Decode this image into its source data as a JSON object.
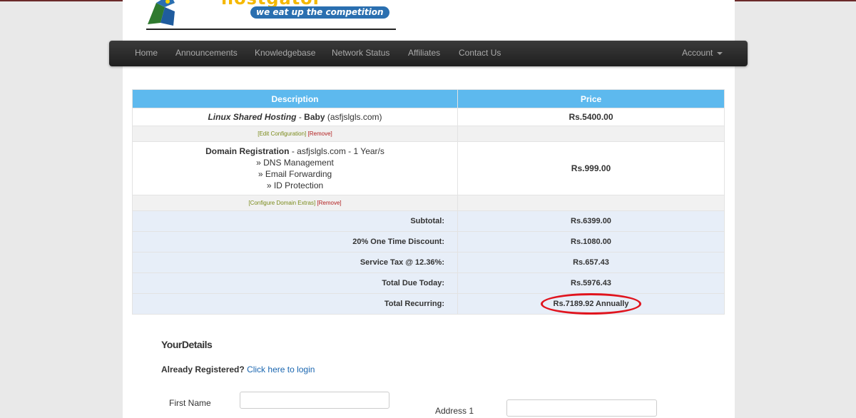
{
  "logo": {
    "brand_text": "hostgator",
    "tagline": "we eat up the competition"
  },
  "navbar": {
    "items": [
      "Home",
      "Announcements",
      "Knowledgebase",
      "Network Status",
      "Affiliates",
      "Contact Us"
    ],
    "account": "Account"
  },
  "cart": {
    "headers": {
      "description": "Description",
      "price": "Price"
    },
    "hosting": {
      "product": "Linux Shared Hosting",
      "separator": " - ",
      "plan": "Baby",
      "domain": " (asfjslgls.com)",
      "price": "Rs.5400.00",
      "edit": "[Edit Configuration]",
      "remove": "[Remove]"
    },
    "domain_reg": {
      "title": "Domain Registration",
      "detail": " - asfjslgls.com - 1 Year/s",
      "addons": [
        "» DNS Management",
        "» Email Forwarding",
        "» ID Protection"
      ],
      "price": "Rs.999.00",
      "configure": "[Configure Domain Extras]",
      "remove": "[Remove]"
    },
    "summary": [
      {
        "label": "Subtotal:",
        "value": "Rs.6399.00"
      },
      {
        "label": "20% One Time Discount:",
        "value": "Rs.1080.00"
      },
      {
        "label": "Service Tax @ 12.36%:",
        "value": "Rs.657.43"
      },
      {
        "label": "Total Due Today:",
        "value": "Rs.5976.43"
      },
      {
        "label": "Total Recurring:",
        "value": "Rs.7189.92 Annually"
      }
    ]
  },
  "details": {
    "title": "YourDetails",
    "already_registered": "Already Registered?",
    "login_link": "Click here to login",
    "first_name_label": "First Name",
    "address1_label": "Address 1"
  },
  "colors": {
    "header_blue": "#5db9ee",
    "summary_bg": "#e7eef8",
    "annotation_red": "#e0141e",
    "link_blue": "#1a66b0"
  }
}
